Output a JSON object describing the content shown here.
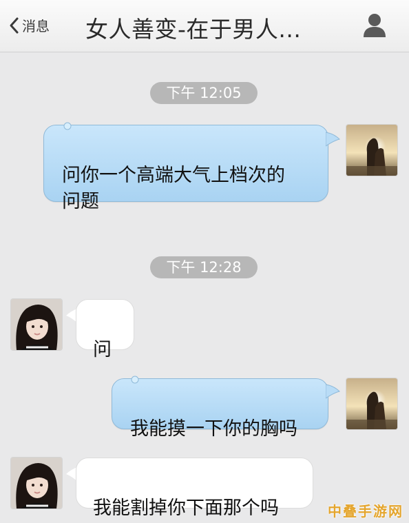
{
  "header": {
    "back_label": "消息",
    "title": "女人善变-在于男人..."
  },
  "messages": [
    {
      "time": "下午 12:05",
      "sender": "self",
      "text": "问你一个高端大气上档次的\n问题"
    },
    {
      "time": "下午 12:28",
      "sender": "other",
      "text": "问"
    },
    {
      "sender": "self",
      "text": "我能摸一下你的胸吗"
    },
    {
      "sender": "other",
      "text": "我能割掉你下面那个吗"
    }
  ],
  "watermark": "中叠手游网",
  "colors": {
    "background": "#e9e9ea",
    "outgoing_bubble": "#b5daf6",
    "incoming_bubble": "#ffffff",
    "timestamp_pill": "#b7b7b7"
  }
}
